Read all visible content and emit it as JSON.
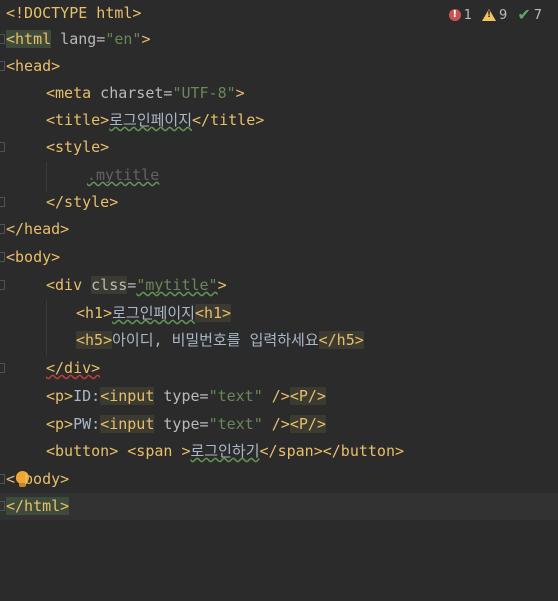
{
  "inspections": {
    "errors": "1",
    "warnings": "9",
    "weak_warnings": "7"
  },
  "code": {
    "l1": "<!DOCTYPE html>",
    "l2_tag": "<html",
    "l2_attr": " lang=",
    "l2_val": "\"en\"",
    "l2_close": ">",
    "l3": "<head>",
    "l4_tag": "<meta",
    "l4_attr": " charset=",
    "l4_val": "\"UTF-8\"",
    "l4_close": ">",
    "l5_open": "<title>",
    "l5_text": "로그인페이지",
    "l5_close": "</title>",
    "l6": "<style>",
    "l7": ".mytitle",
    "l8": "</style>",
    "l9": "</head>",
    "l10": "<body>",
    "l11_tag": "<div",
    "l11_attr": "clss",
    "l11_eq": "=",
    "l11_val": "\"mytitle\"",
    "l11_close": ">",
    "l12_open": "<h1>",
    "l12_text": "로그인페이지",
    "l12_close": "<h1>",
    "l13_open": "<h5>",
    "l13_text": "아이디, 비밀번호를 입력하세요",
    "l13_close": "</h5>",
    "l14": "</div>",
    "l15_p": "<p>",
    "l15_text": "ID:",
    "l15_input": "<input",
    "l15_attr": " type=",
    "l15_val": "\"text\"",
    "l15_end": " />",
    "l15_pclose": "<P/>",
    "l16_p": "<p>",
    "l16_text": "PW:",
    "l16_input": "<input",
    "l16_attr": " type=",
    "l16_val": "\"text\"",
    "l16_end": " />",
    "l16_pclose": "<P/>",
    "l17_open": "<button>",
    "l17_span": " <span >",
    "l17_text": "로그인하기",
    "l17_close": "</span></button>",
    "l18_pre": "<",
    "l18_rest": "body>",
    "l19": "</html>"
  },
  "colors": {
    "background": "#2b2b2b",
    "tag": "#e8bf6a",
    "attribute": "#bababa",
    "string": "#6a8759",
    "text": "#a9b7c6",
    "error": "#c75450",
    "warning": "#f2c55c",
    "ok": "#59a869"
  }
}
